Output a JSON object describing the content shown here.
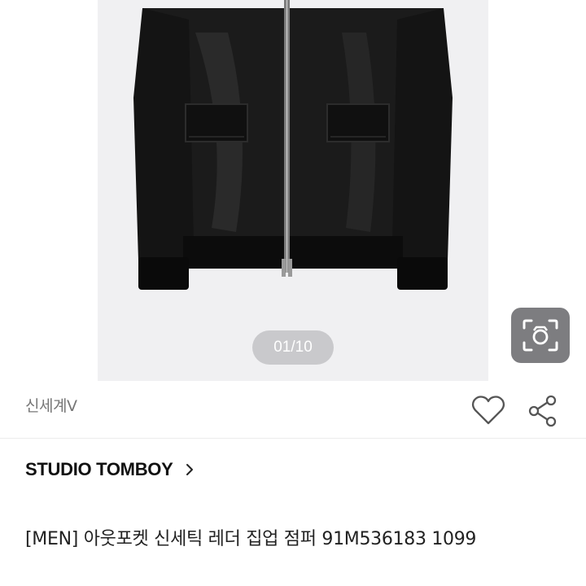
{
  "gallery": {
    "counter": "01/10",
    "current_image": 1,
    "total_images": 10
  },
  "icons": {
    "image_search": "image-search-icon",
    "like": "heart-icon",
    "share": "share-icon",
    "brand_arrow": "chevron-right-icon"
  },
  "seller": {
    "name": "신세계V"
  },
  "brand": {
    "name": "STUDIO TOMBOY"
  },
  "product": {
    "title": "[MEN] 아웃포켓 신세틱 레더 집업 점퍼 91M536183 1099"
  }
}
